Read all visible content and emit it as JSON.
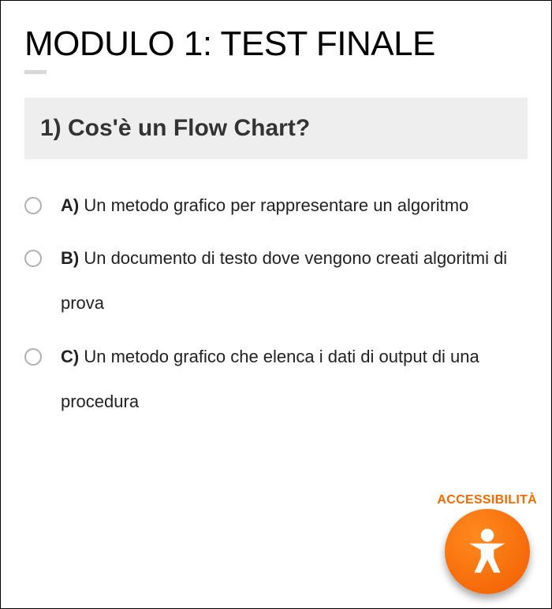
{
  "header": {
    "title": "MODULO 1: TEST FINALE"
  },
  "question": {
    "prompt": "1) Cos'è un Flow Chart?",
    "options": [
      {
        "letter": "A)",
        "text": " Un metodo grafico per rappresentare un algoritmo"
      },
      {
        "letter": "B)",
        "text": " Un documento di testo dove vengono creati algoritmi di prova"
      },
      {
        "letter": "C)",
        "text": " Un metodo grafico che elenca i dati di output di una procedura"
      }
    ]
  },
  "accessibility": {
    "label": "ACCESSIBILITÀ"
  }
}
